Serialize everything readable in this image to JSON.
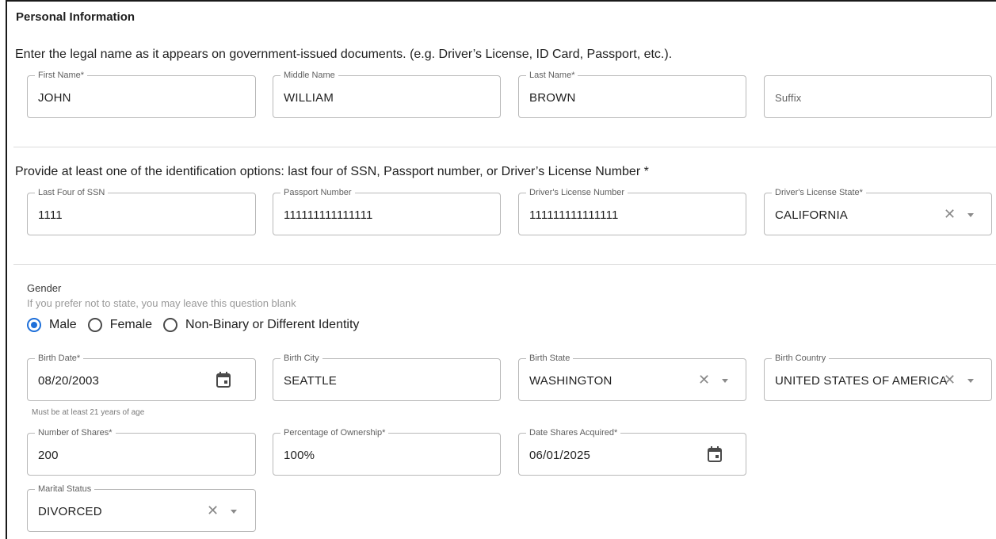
{
  "section": {
    "title": "Personal Information",
    "name_instruction": "Enter the legal name as it appears on government-issued documents. (e.g. Driver’s License, ID Card, Passport, etc.).",
    "id_instruction": "Provide at least one of the identification options: last four of SSN, Passport number, or Driver’s License Number *"
  },
  "name": {
    "first": {
      "label": "First Name*",
      "value": "JOHN"
    },
    "middle": {
      "label": "Middle Name",
      "value": "WILLIAM"
    },
    "last": {
      "label": "Last Name*",
      "value": "BROWN"
    },
    "suffix": {
      "placeholder": "Suffix"
    }
  },
  "identification": {
    "ssn": {
      "label": "Last Four of SSN",
      "value": "1111"
    },
    "passport": {
      "label": "Passport Number",
      "value": "111111111111111"
    },
    "license": {
      "label": "Driver's License Number",
      "value": "111111111111111"
    },
    "license_state": {
      "label": "Driver's License State*",
      "value": "CALIFORNIA"
    }
  },
  "gender": {
    "title": "Gender",
    "hint": "If you prefer not to state, you may leave this question blank",
    "options": [
      "Male",
      "Female",
      "Non-Binary or Different Identity"
    ],
    "selected": "Male"
  },
  "birth": {
    "date": {
      "label": "Birth Date*",
      "value": "08/20/2003",
      "helper": "Must be at least 21 years of age"
    },
    "city": {
      "label": "Birth City",
      "value": "SEATTLE"
    },
    "state": {
      "label": "Birth State",
      "value": "WASHINGTON"
    },
    "country": {
      "label": "Birth Country",
      "value": "UNITED STATES OF AMERICA"
    }
  },
  "ownership": {
    "shares": {
      "label": "Number of Shares*",
      "value": "200"
    },
    "percentage": {
      "label": "Percentage of Ownership*",
      "value": "100%"
    },
    "date_acquired": {
      "label": "Date Shares Acquired*",
      "value": "06/01/2025"
    }
  },
  "marital": {
    "label": "Marital Status",
    "value": "DIVORCED"
  },
  "icons": {
    "clear": "close-icon",
    "dropdown": "caret-down-icon",
    "calendar": "calendar-icon"
  },
  "colors": {
    "accent": "#1e6fd9",
    "border": "#b8b8b8",
    "text": "#212121"
  }
}
